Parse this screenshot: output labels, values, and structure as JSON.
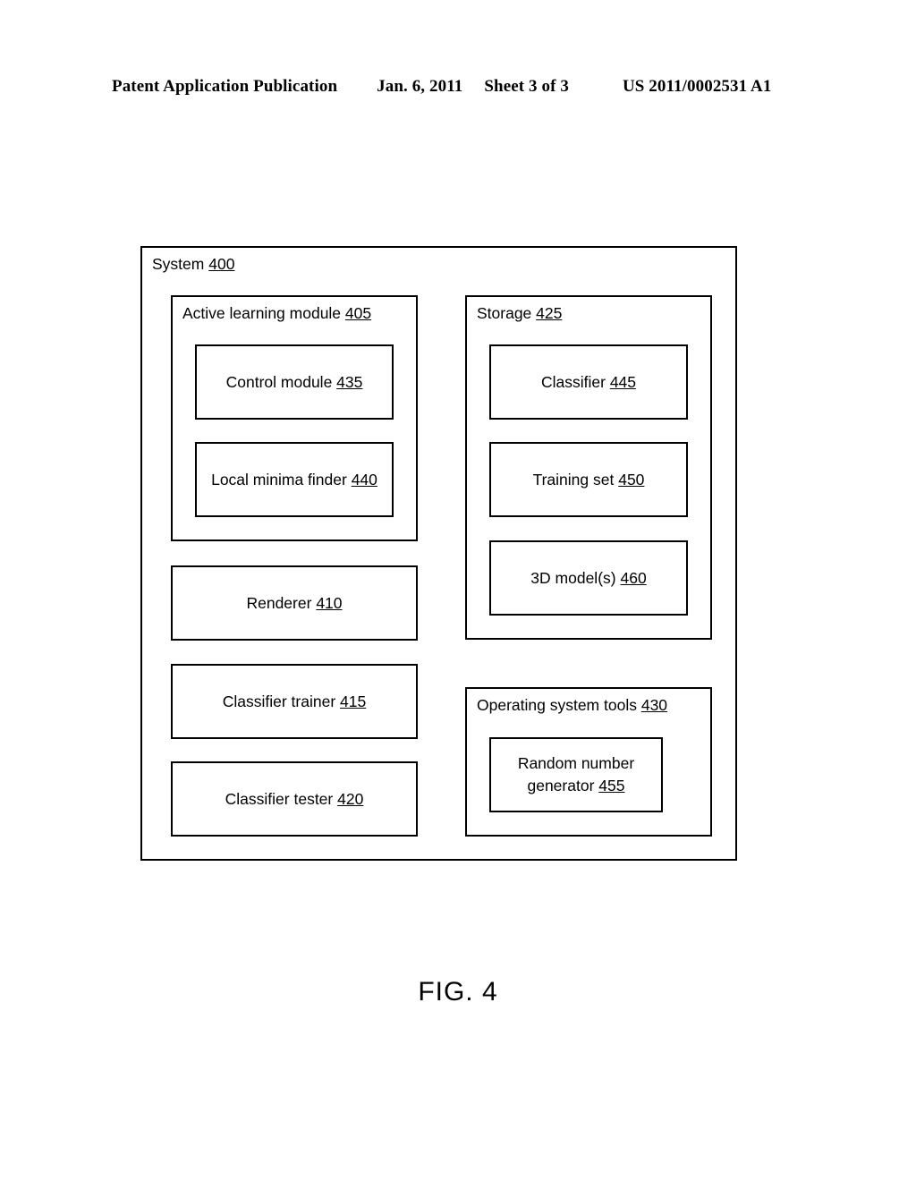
{
  "header": {
    "publication": "Patent Application Publication",
    "date": "Jan. 6, 2011",
    "sheet": "Sheet 3 of 3",
    "document_number": "US 2011/0002531 A1"
  },
  "figure": {
    "caption": "FIG. 4",
    "system": {
      "label": "System",
      "ref": "400"
    },
    "active_learning_module": {
      "label": "Active learning module",
      "ref": "405",
      "children": [
        {
          "label": "Control module",
          "ref": "435"
        },
        {
          "label": "Local minima finder",
          "ref": "440"
        }
      ]
    },
    "renderer": {
      "label": "Renderer",
      "ref": "410"
    },
    "classifier_trainer": {
      "label": "Classifier trainer",
      "ref": "415"
    },
    "classifier_tester": {
      "label": "Classifier tester",
      "ref": "420"
    },
    "storage": {
      "label": "Storage",
      "ref": "425",
      "children": [
        {
          "label": "Classifier",
          "ref": "445"
        },
        {
          "label": "Training set",
          "ref": "450"
        },
        {
          "label": "3D model(s)",
          "ref": "460"
        }
      ]
    },
    "operating_system_tools": {
      "label": "Operating system tools",
      "ref": "430",
      "children": [
        {
          "label": "Random number",
          "label2": "generator",
          "ref": "455"
        }
      ]
    }
  }
}
